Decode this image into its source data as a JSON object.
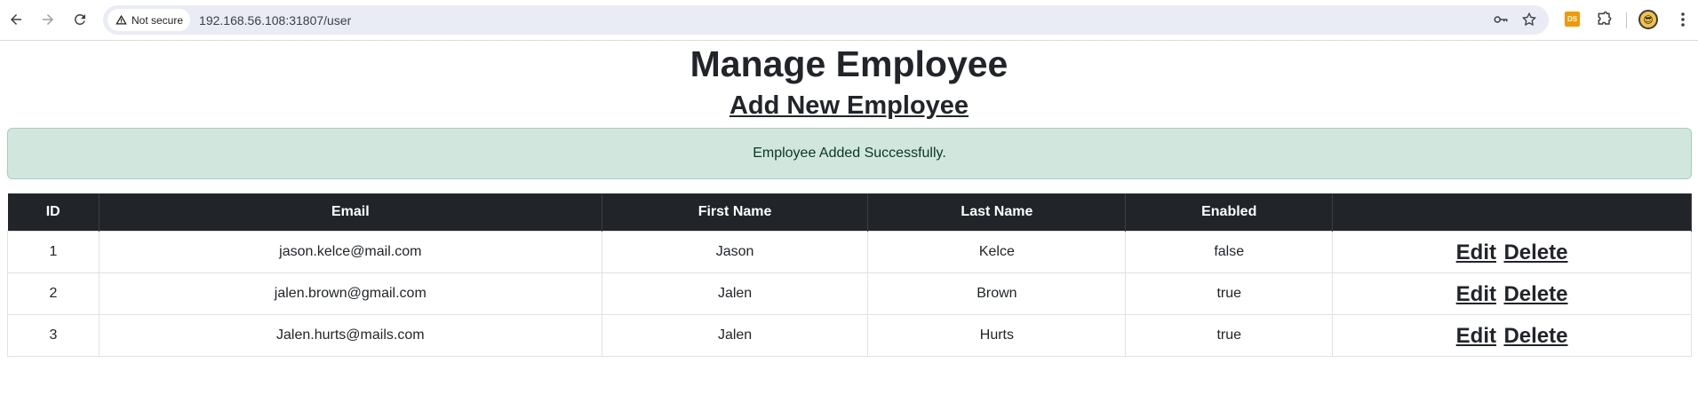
{
  "browser": {
    "security_label": "Not secure",
    "url": "192.168.56.108:31807/user",
    "extension_badge": "DS"
  },
  "page": {
    "title": "Manage Employee",
    "add_link": "Add New Employee",
    "alert": "Employee Added Successfully."
  },
  "table": {
    "headers": [
      "ID",
      "Email",
      "First Name",
      "Last Name",
      "Enabled",
      ""
    ],
    "rows": [
      {
        "id": "1",
        "email": "jason.kelce@mail.com",
        "first": "Jason",
        "last": "Kelce",
        "enabled": "false"
      },
      {
        "id": "2",
        "email": "jalen.brown@gmail.com",
        "first": "Jalen",
        "last": "Brown",
        "enabled": "true"
      },
      {
        "id": "3",
        "email": "Jalen.hurts@mails.com",
        "first": "Jalen",
        "last": "Hurts",
        "enabled": "true"
      }
    ],
    "edit_label": "Edit",
    "delete_label": "Delete"
  },
  "colors": {
    "header_bg": "#212529",
    "alert_bg": "#d1e7dd",
    "alert_text": "#0a3622"
  }
}
